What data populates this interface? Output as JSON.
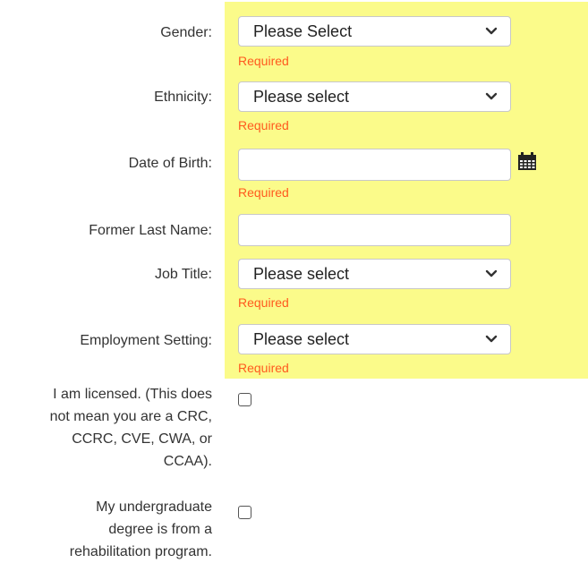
{
  "form": {
    "required_text": "Required",
    "gender": {
      "label": "Gender:",
      "value": "Please Select",
      "required": "Required"
    },
    "ethnicity": {
      "label": "Ethnicity:",
      "value": "Please select",
      "required": "Required"
    },
    "dob": {
      "label": "Date of Birth:",
      "value": "",
      "required": "Required"
    },
    "former_last_name": {
      "label": "Former Last Name:",
      "value": ""
    },
    "job_title": {
      "label": "Job Title:",
      "value": "Please select",
      "required": "Required"
    },
    "employment_setting": {
      "label": "Employment Setting:",
      "value": "Please select",
      "required": "Required"
    },
    "licensed": {
      "label_lines": [
        "I am licensed. (This does",
        "not mean you are a CRC,",
        "CCRC, CVE, CWA, or",
        "CCAA)."
      ],
      "checked": false
    },
    "undergrad_rehab": {
      "label_lines": [
        "My undergraduate",
        "degree is from a",
        "rehabilitation program."
      ],
      "checked": false
    }
  },
  "colors": {
    "highlight": "#fbfb8a",
    "required": "#ff5a1f",
    "border": "#c8c8c8"
  },
  "icons": {
    "select_arrow": "chevron-down-icon",
    "date_picker": "calendar-icon"
  }
}
